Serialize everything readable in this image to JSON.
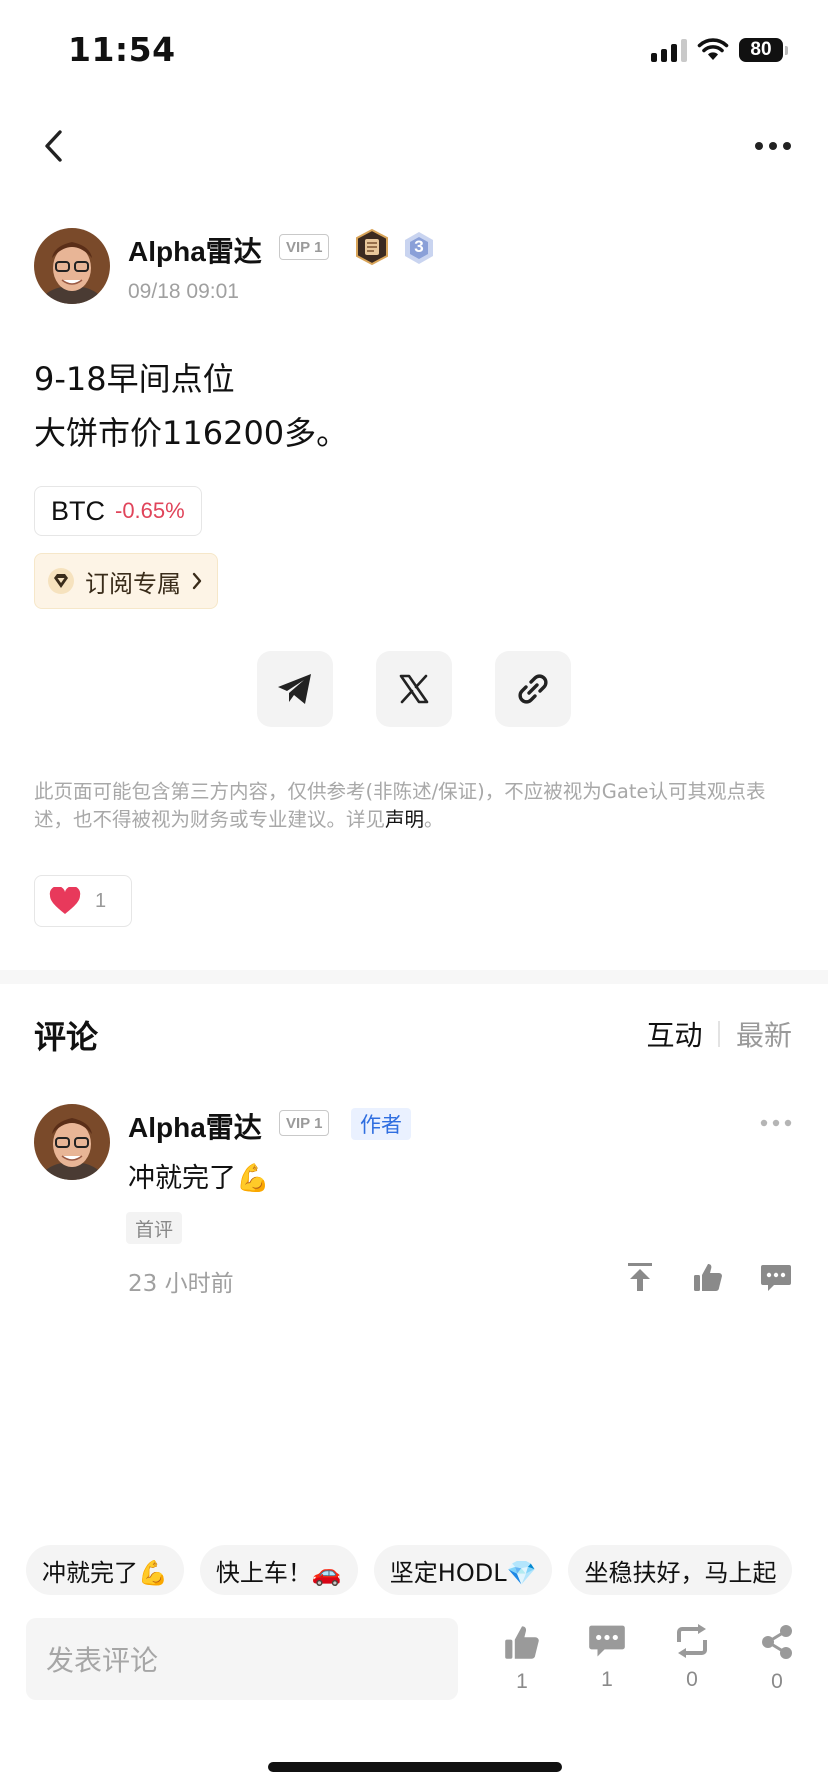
{
  "status_bar": {
    "time": "11:54",
    "battery": "80"
  },
  "post": {
    "author": "Alpha雷达",
    "vip": "VIP 1",
    "level": "3",
    "time": "09/18 09:01",
    "lines": [
      "9-18早间点位",
      "大饼市价116200多。"
    ],
    "coin": {
      "symbol": "BTC",
      "change": "-0.65%"
    },
    "subscribe_label": "订阅专属"
  },
  "disclaimer": {
    "text": "此页面可能包含第三方内容，仅供参考(非陈述/保证)，不应被视为Gate认可其观点表述，也不得被视为财务或专业建议。详见",
    "link": "声明",
    "end": "。"
  },
  "reactions": {
    "likes": "1"
  },
  "comments": {
    "title": "评论",
    "sort_tabs": [
      "互动",
      "最新"
    ],
    "items": [
      {
        "author": "Alpha雷达",
        "vip": "VIP 1",
        "badge": "作者",
        "text": "冲就完了💪",
        "tag": "首评",
        "time": "23 小时前"
      }
    ]
  },
  "quick_replies": [
    "冲就完了💪",
    "快上车！🚗",
    "坚定HODL💎",
    "坐稳扶好，马上起"
  ],
  "bottom_bar": {
    "input_placeholder": "发表评论",
    "actions": [
      {
        "icon": "thumbs-up-icon",
        "count": "1"
      },
      {
        "icon": "comment-icon",
        "count": "1"
      },
      {
        "icon": "repost-icon",
        "count": "0"
      },
      {
        "icon": "share-icon",
        "count": "0"
      }
    ]
  },
  "colors": {
    "negative": "#e0445a",
    "author_badge": "#2f6ee0",
    "subscribe_bg": "#fdf4e6"
  }
}
